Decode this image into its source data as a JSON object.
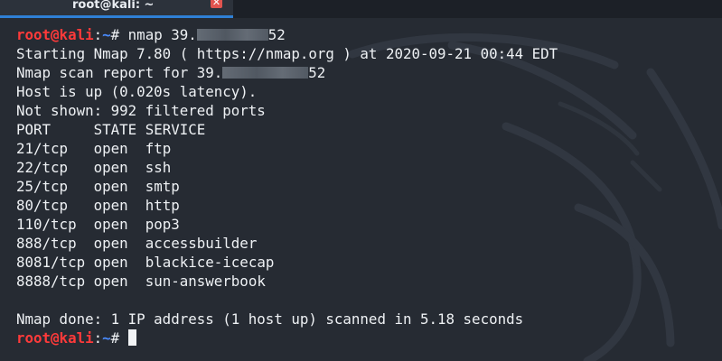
{
  "window": {
    "tab_title": "root@kali: ~",
    "close_glyph": "✕"
  },
  "prompt": {
    "user_host": "root@kali",
    "colon": ":",
    "path": "~",
    "symbol": "#"
  },
  "command": {
    "text_before": " nmap 39.",
    "text_after": "52"
  },
  "output": {
    "starting": "Starting Nmap 7.80 ( https://nmap.org ) at 2020-09-21 00:44 EDT",
    "report_before": "Nmap scan report for 39.",
    "report_after": "52",
    "host_up": "Host is up (0.020s latency).",
    "not_shown": "Not shown: 992 filtered ports",
    "header": {
      "port": "PORT",
      "state": "STATE",
      "service": "SERVICE"
    },
    "ports": [
      {
        "port": "21/tcp",
        "state": "open",
        "service": "ftp"
      },
      {
        "port": "22/tcp",
        "state": "open",
        "service": "ssh"
      },
      {
        "port": "25/tcp",
        "state": "open",
        "service": "smtp"
      },
      {
        "port": "80/tcp",
        "state": "open",
        "service": "http"
      },
      {
        "port": "110/tcp",
        "state": "open",
        "service": "pop3"
      },
      {
        "port": "888/tcp",
        "state": "open",
        "service": "accessbuilder"
      },
      {
        "port": "8081/tcp",
        "state": "open",
        "service": "blackice-icecap"
      },
      {
        "port": "8888/tcp",
        "state": "open",
        "service": "sun-answerbook"
      }
    ],
    "done": "Nmap done: 1 IP address (1 host up) scanned in 5.18 seconds"
  },
  "colors": {
    "background": "#262b33",
    "prompt_user": "#ff3a3a",
    "prompt_path": "#4a8cff",
    "tab_accent": "#2f80d6",
    "close_button": "#e0544f"
  },
  "icons": {
    "tab_close": "close-icon",
    "background": "kali-dragon-watermark-icon",
    "cursor": "block-cursor-icon"
  }
}
